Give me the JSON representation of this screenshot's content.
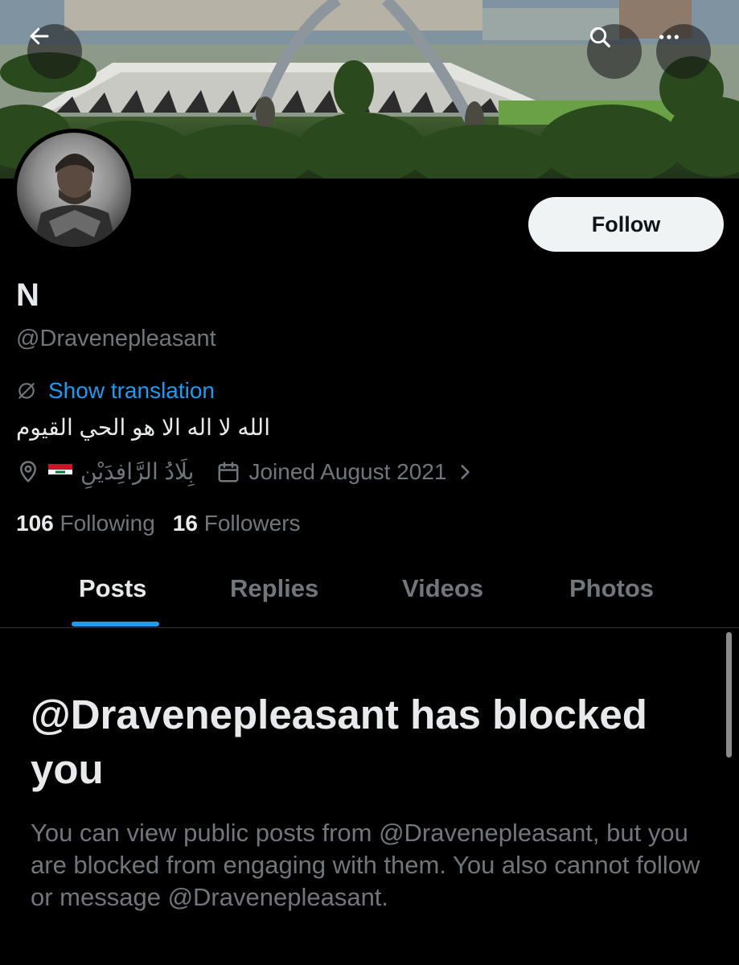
{
  "header": {
    "back_icon": "arrow-left-icon",
    "search_icon": "search-icon",
    "more_icon": "more-horizontal-icon"
  },
  "profile": {
    "display_name": "N",
    "handle": "@Dravenepleasant",
    "follow_label": "Follow",
    "translate_icon": "translate-icon",
    "translate_label": "Show translation",
    "bio": "الله لا اله الا هو الحي القيوم",
    "location_icon": "location-pin-icon",
    "location": "بِلَادُ الرَّافِدَيْنِ",
    "calendar_icon": "calendar-icon",
    "joined": "Joined August 2021",
    "chevron_icon": "chevron-right-icon",
    "following_count": "106",
    "following_label": "Following",
    "followers_count": "16",
    "followers_label": "Followers"
  },
  "tabs": [
    {
      "label": "Posts",
      "active": true
    },
    {
      "label": "Replies",
      "active": false
    },
    {
      "label": "Videos",
      "active": false
    },
    {
      "label": "Photos",
      "active": false
    }
  ],
  "blocked": {
    "title": "@Dravenepleasant has blocked you",
    "description": "You can view public posts from @Dravenepleasant, but you are blocked from engaging with them. You also cannot follow or message @Dravenepleasant."
  },
  "colors": {
    "accent": "#1d9bf0",
    "background": "#000000",
    "text_primary": "#e7e9ea",
    "text_secondary": "#71767b"
  }
}
